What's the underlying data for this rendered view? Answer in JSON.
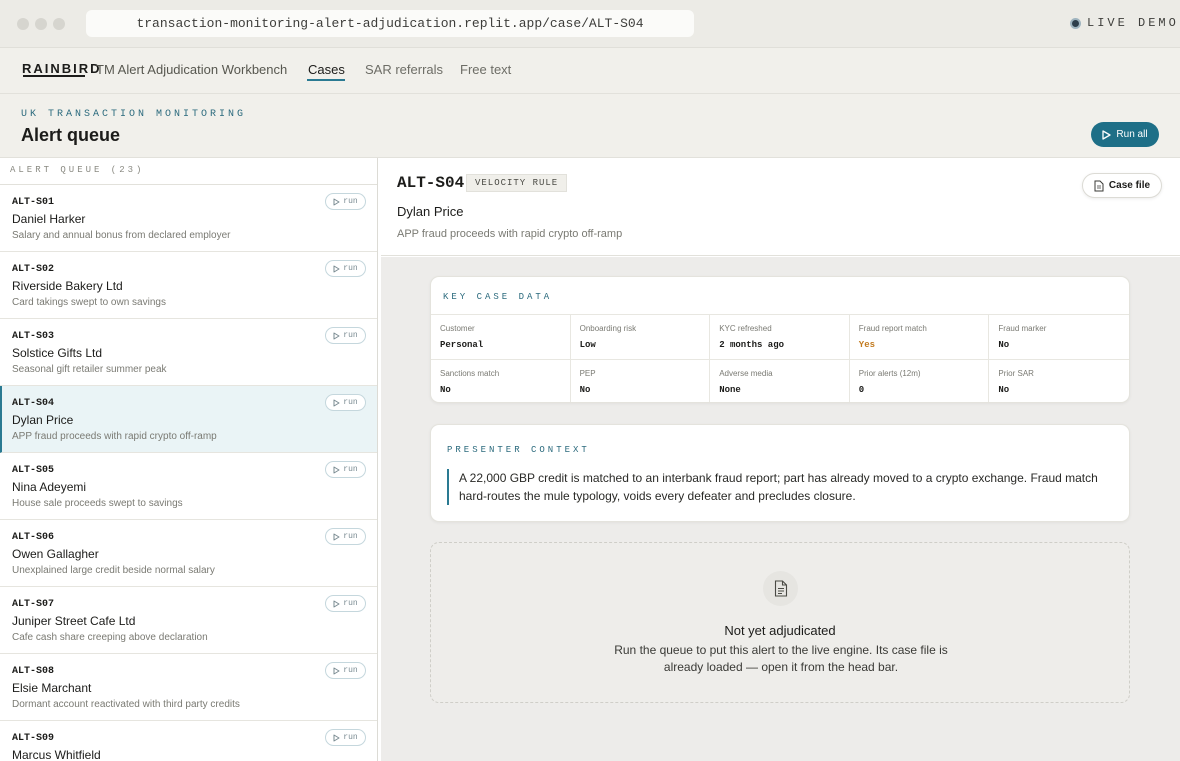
{
  "browser": {
    "url": "transaction-monitoring-alert-adjudication.replit.app/case/ALT-S04",
    "live_label": "LIVE DEMO"
  },
  "nav": {
    "logo": "RAINBIRD",
    "app_name": "TM Alert Adjudication Workbench",
    "links": [
      "Cases",
      "SAR referrals",
      "Free text"
    ],
    "active": "Cases"
  },
  "header": {
    "eyebrow": "UK TRANSACTION MONITORING",
    "title": "Alert queue",
    "run_all": "Run all"
  },
  "queue": {
    "heading": "ALERT QUEUE (23)",
    "run_label": "run",
    "items": [
      {
        "id": "ALT-S01",
        "name": "Daniel Harker",
        "desc": "Salary and annual bonus from declared employer"
      },
      {
        "id": "ALT-S02",
        "name": "Riverside Bakery Ltd",
        "desc": "Card takings swept to own savings"
      },
      {
        "id": "ALT-S03",
        "name": "Solstice Gifts Ltd",
        "desc": "Seasonal gift retailer summer peak"
      },
      {
        "id": "ALT-S04",
        "name": "Dylan Price",
        "desc": "APP fraud proceeds with rapid crypto off-ramp"
      },
      {
        "id": "ALT-S05",
        "name": "Nina Adeyemi",
        "desc": "House sale proceeds swept to savings"
      },
      {
        "id": "ALT-S06",
        "name": "Owen Gallagher",
        "desc": "Unexplained large credit beside normal salary"
      },
      {
        "id": "ALT-S07",
        "name": "Juniper Street Cafe Ltd",
        "desc": "Cafe cash share creeping above declaration"
      },
      {
        "id": "ALT-S08",
        "name": "Elsie Marchant",
        "desc": "Dormant account reactivated with third party credits"
      },
      {
        "id": "ALT-S09",
        "name": "Marcus Whitfield",
        "desc": ""
      }
    ],
    "selected": "ALT-S04"
  },
  "case": {
    "id": "ALT-S04",
    "tag": "VELOCITY RULE",
    "name": "Dylan Price",
    "summary": "APP fraud proceeds with rapid crypto off-ramp",
    "case_file": "Case file"
  },
  "key_case_data": {
    "label": "KEY CASE DATA",
    "cells": [
      {
        "label": "Customer",
        "value": "Personal"
      },
      {
        "label": "Onboarding risk",
        "value": "Low"
      },
      {
        "label": "KYC refreshed",
        "value": "2 months ago"
      },
      {
        "label": "Fraud report match",
        "value": "Yes",
        "warn": true
      },
      {
        "label": "Fraud marker",
        "value": "No"
      },
      {
        "label": "Sanctions match",
        "value": "No"
      },
      {
        "label": "PEP",
        "value": "No"
      },
      {
        "label": "Adverse media",
        "value": "None"
      },
      {
        "label": "Prior alerts (12m)",
        "value": "0"
      },
      {
        "label": "Prior SAR",
        "value": "No"
      }
    ]
  },
  "presenter_context": {
    "label": "PRESENTER CONTEXT",
    "text": "A 22,000 GBP credit is matched to an interbank fraud report; part has already moved to a crypto exchange. Fraud match hard-routes the mule typology, voids every defeater and precludes closure."
  },
  "empty_state": {
    "title": "Not yet adjudicated",
    "body": "Run the queue to put this alert to the live engine. Its case file is already loaded — open it from the head bar."
  }
}
